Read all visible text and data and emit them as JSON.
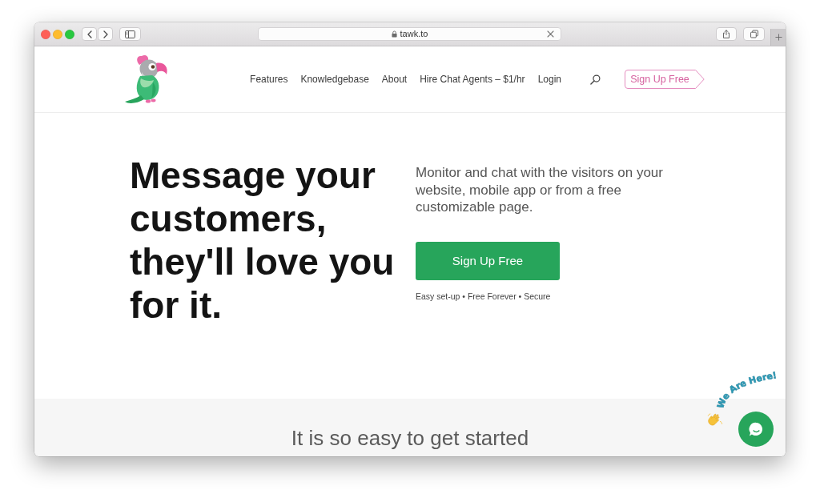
{
  "browser": {
    "url": "tawk.to"
  },
  "nav": {
    "items": [
      "Features",
      "Knowledgebase",
      "About",
      "Hire Chat Agents – $1/hr",
      "Login"
    ],
    "button": "Sign Up Free"
  },
  "hero": {
    "headline": "Message your customers, they'll love you for it.",
    "description": "Monitor and chat with the visitors on your website, mobile app or from a free customizable page.",
    "button": "Sign Up Free",
    "highlights": "Easy set-up • Free Forever • Secure"
  },
  "next_section": {
    "heading": "It is so easy to get started"
  },
  "chat_widget": {
    "caption": "We Are Here!"
  }
}
